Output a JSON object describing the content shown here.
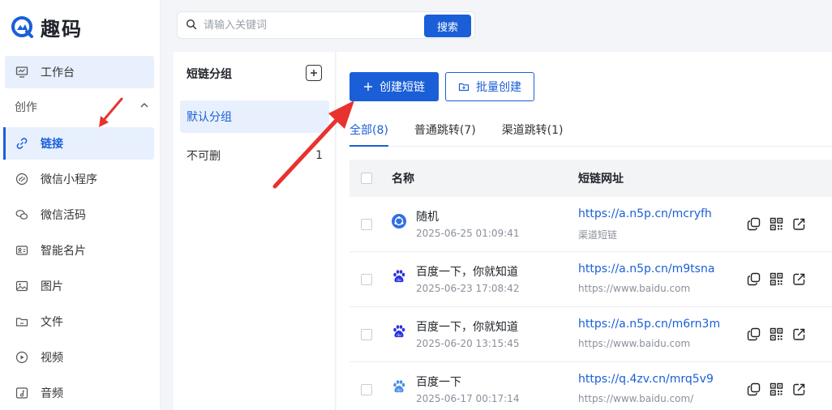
{
  "app": {
    "name": "趣码"
  },
  "sidebar": {
    "workbench": "工作台",
    "group_label": "创作",
    "items": [
      {
        "label": "链接",
        "icon": "link-icon"
      },
      {
        "label": "微信小程序",
        "icon": "mini-program-icon"
      },
      {
        "label": "微信活码",
        "icon": "wechat-icon"
      },
      {
        "label": "智能名片",
        "icon": "card-icon"
      },
      {
        "label": "图片",
        "icon": "image-icon"
      },
      {
        "label": "文件",
        "icon": "folder-icon"
      },
      {
        "label": "视频",
        "icon": "video-icon"
      },
      {
        "label": "音频",
        "icon": "audio-icon"
      }
    ]
  },
  "search": {
    "placeholder": "请输入关键词",
    "button": "搜索"
  },
  "groups": {
    "title": "短链分组",
    "items": [
      {
        "label": "默认分组",
        "count": ""
      },
      {
        "label": "不可删",
        "count": "1"
      }
    ]
  },
  "toolbar": {
    "create": "创建短链",
    "batch": "批量创建"
  },
  "tabs": [
    "全部(8)",
    "普通跳转(7)",
    "渠道跳转(1)"
  ],
  "table": {
    "headers": {
      "name": "名称",
      "url": "短链网址"
    },
    "rows": [
      {
        "name": "随机",
        "time": "2025-06-25 01:09:41",
        "url": "https://a.n5p.cn/mcryfh",
        "sub": "渠道短链",
        "icon": "channel-icon"
      },
      {
        "name": "百度一下，你就知道",
        "time": "2025-06-23 17:08:42",
        "url": "https://a.n5p.cn/m9tsna",
        "sub": "https://www.baidu.com",
        "icon": "baidu-icon"
      },
      {
        "name": "百度一下，你就知道",
        "time": "2025-06-20 13:15:45",
        "url": "https://a.n5p.cn/m6rn3m",
        "sub": "https://www.baidu.com",
        "icon": "baidu-icon"
      },
      {
        "name": "百度一下",
        "time": "2025-06-17 00:17:14",
        "url": "https://q.4zv.cn/mrq5v9",
        "sub": "https://www.baidu.com/",
        "icon": "baidu-icon"
      }
    ]
  },
  "colors": {
    "primary": "#1a5fd8",
    "annotation": "#e8322f"
  }
}
